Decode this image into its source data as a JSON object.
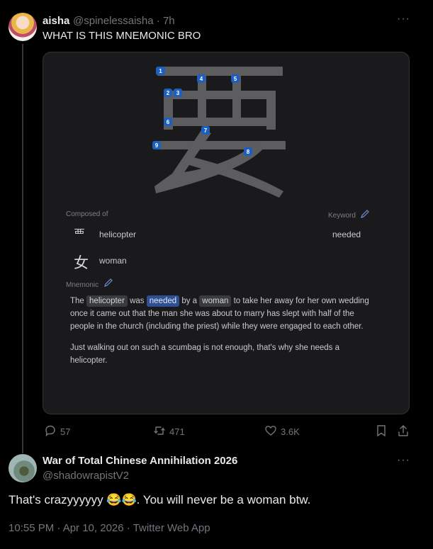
{
  "tweet1": {
    "name": "aisha",
    "handle": "@spinelessaisha · 7h",
    "more": "···",
    "text": "WHAT IS THIS MNEMONIC BRO",
    "card": {
      "stroke_numbers": [
        "1",
        "2",
        "3",
        "4",
        "5",
        "6",
        "7",
        "8",
        "9"
      ],
      "composed_label": "Composed of",
      "components": [
        {
          "glyph": "覀",
          "label": "helicopter"
        },
        {
          "glyph": "女",
          "label": "woman"
        }
      ],
      "keyword_label": "Keyword",
      "keyword_value": "needed",
      "mnemonic_label": "Mnemonic",
      "mnemonic": {
        "p1_the": "The",
        "chip_helicopter": "helicopter",
        "p1_was": "was",
        "chip_needed": "needed",
        "p1_bya": "by a",
        "chip_woman": "woman",
        "p1_rest": "to take her away for her own wedding once it came out that the man she was about to marry has slept with half of the people in the church (including the priest) while they were engaged to each other.",
        "p2": "Just walking out on such a scumbag is not enough, that's why she needs a helicopter."
      }
    },
    "actions": {
      "replies": "57",
      "retweets": "471",
      "likes": "3.6K"
    }
  },
  "tweet2": {
    "name": "War of Total Chinese Annihilation 2026",
    "handle": "@shadowrapistV2",
    "more": "···",
    "text": "That's crazyyyyyy 😂😂. You will never be a woman btw.",
    "timestamp": "10:55 PM · Apr 10, 2026 · Twitter Web App"
  },
  "colors": {
    "background": "#000000",
    "card": "#1a1a1c",
    "muted": "#71767b",
    "keyword_chip": "#2f4f95",
    "stroke_badge": "#1d5fbf"
  }
}
